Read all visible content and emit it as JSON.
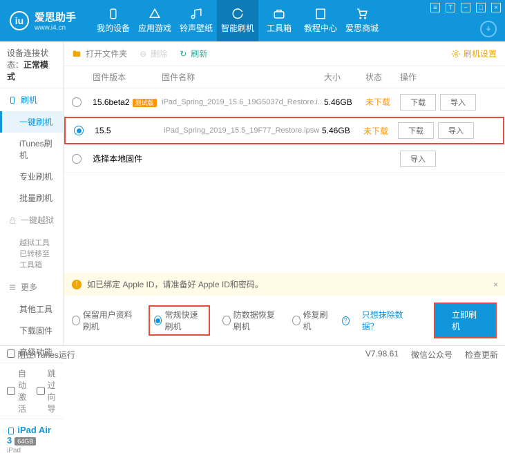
{
  "header": {
    "brand": "爱思助手",
    "url": "www.i4.cn",
    "nav": [
      {
        "label": "我的设备"
      },
      {
        "label": "应用游戏"
      },
      {
        "label": "铃声壁纸"
      },
      {
        "label": "智能刷机"
      },
      {
        "label": "工具箱"
      },
      {
        "label": "教程中心"
      },
      {
        "label": "爱思商城"
      }
    ]
  },
  "side": {
    "conn_label": "设备连接状态：",
    "conn_value": "正常模式",
    "grp1": "刷机",
    "items1": [
      "一键刷机",
      "iTunes刷机",
      "专业刷机",
      "批量刷机"
    ],
    "grp2": "一键越狱",
    "note": "越狱工具已转移至工具箱",
    "grp3": "更多",
    "items3": [
      "其他工具",
      "下载固件",
      "高级功能"
    ],
    "auto_activate": "自动激活",
    "skip_guide": "跳过向导",
    "device_name": "iPad Air 3",
    "device_cap": "64GB",
    "device_type": "iPad"
  },
  "toolbar": {
    "open": "打开文件夹",
    "delete": "删除",
    "refresh": "刷新",
    "settings": "刷机设置"
  },
  "thead": {
    "ver": "固件版本",
    "name": "固件名称",
    "size": "大小",
    "status": "状态",
    "action": "操作"
  },
  "rows": [
    {
      "ver": "15.6beta2",
      "beta": "测试版",
      "name": "iPad_Spring_2019_15.6_19G5037d_Restore.i...",
      "size": "5.46GB",
      "status": "未下载",
      "selected": false
    },
    {
      "ver": "15.5",
      "beta": "",
      "name": "iPad_Spring_2019_15.5_19F77_Restore.ipsw",
      "size": "5.46GB",
      "status": "未下载",
      "selected": true
    },
    {
      "ver": "选择本地固件",
      "beta": "",
      "name": "",
      "size": "",
      "status": "",
      "selected": false,
      "local": true
    }
  ],
  "btns": {
    "download": "下载",
    "import": "导入"
  },
  "warn": "如已绑定 Apple ID，请准备好 Apple ID和密码。",
  "modes": {
    "m1": "保留用户资料刷机",
    "m2": "常规快速刷机",
    "m3": "防数据恢复刷机",
    "m4": "修复刷机",
    "help": "只想抹除数据？",
    "go": "立即刷机"
  },
  "foot": {
    "block": "阻止iTunes运行",
    "ver": "V7.98.61",
    "wechat": "微信公众号",
    "update": "检查更新"
  }
}
